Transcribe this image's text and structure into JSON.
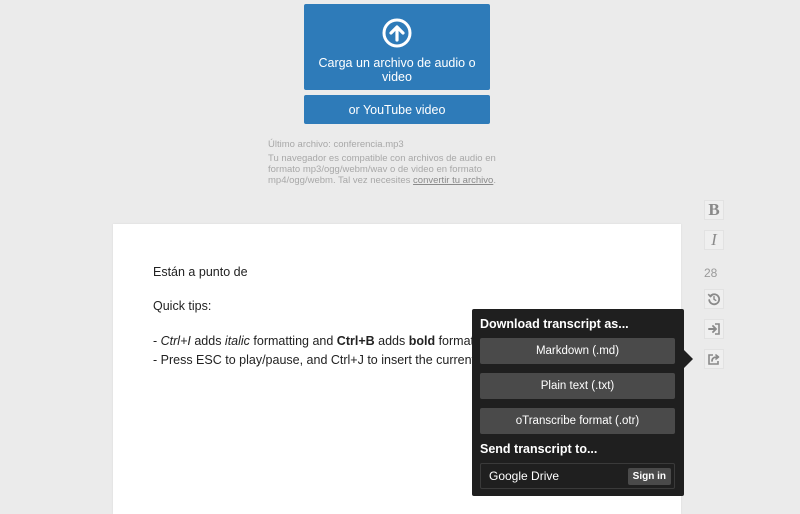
{
  "upload": {
    "icon": "upload-arrow-icon",
    "label": "Carga un archivo de audio o video",
    "youtube_label": "or YouTube video"
  },
  "file_info": {
    "last_file": "Último archivo: conferencia.mp3",
    "compat_text": "Tu navegador es compatible con archivos de audio en formato mp3/ogg/webm/wav o de video en formato mp4/ogg/webm. Tal vez necesites ",
    "convert_link": "convertir tu archivo",
    "period": "."
  },
  "editor": {
    "line1": "Están a punto de",
    "line2": "Quick tips:",
    "tip1_prefix": "- ",
    "tip1_key1": "Ctrl+I",
    "tip1_mid1": " adds ",
    "tip1_italic": "italic",
    "tip1_mid2": " formatting and ",
    "tip1_key2": "Ctrl+B",
    "tip1_mid3": " adds ",
    "tip1_bold": "bold",
    "tip1_suffix": " formatting.",
    "tip2": "- Press ESC to play/pause, and Ctrl+J to insert the current timestamp."
  },
  "toolbar": {
    "bold": "B",
    "italic": "I",
    "speed": "28",
    "icons": [
      "reset-icon",
      "import-icon",
      "export-icon"
    ]
  },
  "export_panel": {
    "download_heading": "Download transcript as...",
    "markdown": "Markdown (.md)",
    "plain": "Plain text (.txt)",
    "otr": "oTranscribe format (.otr)",
    "send_heading": "Send transcript to...",
    "gdrive": "Google Drive",
    "signin": "Sign in"
  },
  "colors": {
    "accent": "#2e7bb9",
    "panel_bg": "#1f1f1f",
    "panel_button": "#4a4a4a",
    "page_bg": "#ebebeb"
  }
}
